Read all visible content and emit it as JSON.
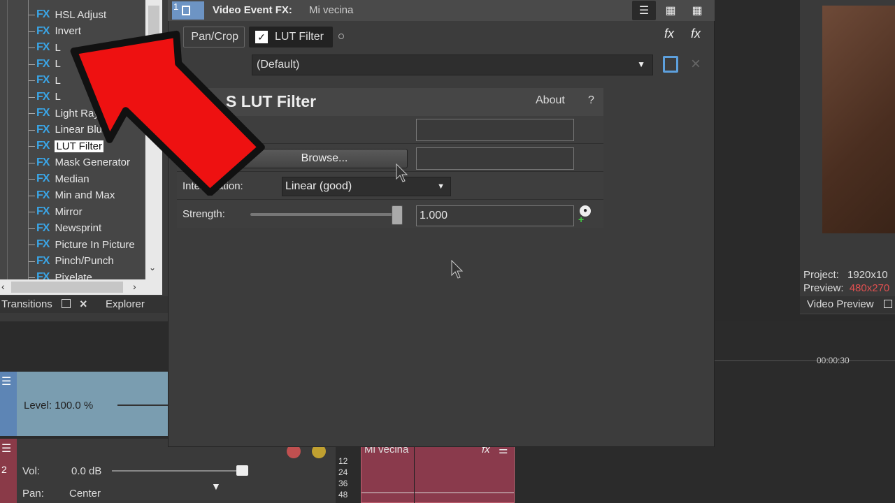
{
  "fx_list": {
    "items": [
      {
        "badge": "FX",
        "name": "HSL Adjust"
      },
      {
        "badge": "FX",
        "name": "Invert"
      },
      {
        "badge": "FX",
        "name": "L"
      },
      {
        "badge": "FX",
        "name": "L"
      },
      {
        "badge": "FX",
        "name": "L"
      },
      {
        "badge": "FX",
        "name": "L"
      },
      {
        "badge": "FX",
        "name": "Light Rays"
      },
      {
        "badge": "FX",
        "name": "Linear Blur"
      },
      {
        "badge": "FX",
        "name": "LUT Filter",
        "selected": true
      },
      {
        "badge": "FX",
        "name": "Mask Generator"
      },
      {
        "badge": "FX",
        "name": "Median"
      },
      {
        "badge": "FX",
        "name": "Min and Max"
      },
      {
        "badge": "FX",
        "name": "Mirror"
      },
      {
        "badge": "FX",
        "name": "Newsprint"
      },
      {
        "badge": "FX",
        "name": "Picture In Picture"
      },
      {
        "badge": "FX",
        "name": "Pinch/Punch"
      },
      {
        "badge": "FX",
        "name": "Pixelate"
      }
    ]
  },
  "tabs": {
    "transitions": "Transitions",
    "explorer": "Explorer"
  },
  "dialog": {
    "title_label": "Video Event FX:",
    "title_value": "Mi vecina",
    "track_index": "1",
    "chain_pancrop": "Pan/Crop",
    "chain_lut": "LUT Filter",
    "preset": "(Default)",
    "plugin_title": "S LUT Filter",
    "about": "About",
    "help": "?",
    "browse_label": "Browse...",
    "interpolation_label": "Interpolation:",
    "interpolation_value": "Linear (good)",
    "strength_label": "Strength:",
    "strength_value": "1.000",
    "strength_fraction": 1.0
  },
  "right_panel": {
    "project_label": "Project:",
    "project_value": "1920x10",
    "preview_label": "Preview:",
    "preview_value": "480x270",
    "video_preview": "Video Preview"
  },
  "timeline": {
    "time_marker": "00:00:30",
    "level": "Level: 100.0 %",
    "vol_label": "Vol:",
    "vol_value": "0.0 dB",
    "pan_label": "Pan:",
    "pan_value": "Center",
    "track2_index": "2",
    "clip_name": "Mi vecina",
    "meter_ticks": [
      "12",
      "24",
      "36",
      "48"
    ]
  },
  "colors": {
    "accent": "#3aa6e8",
    "arrow": "#ee1111",
    "clip": "#8a3a4c"
  }
}
